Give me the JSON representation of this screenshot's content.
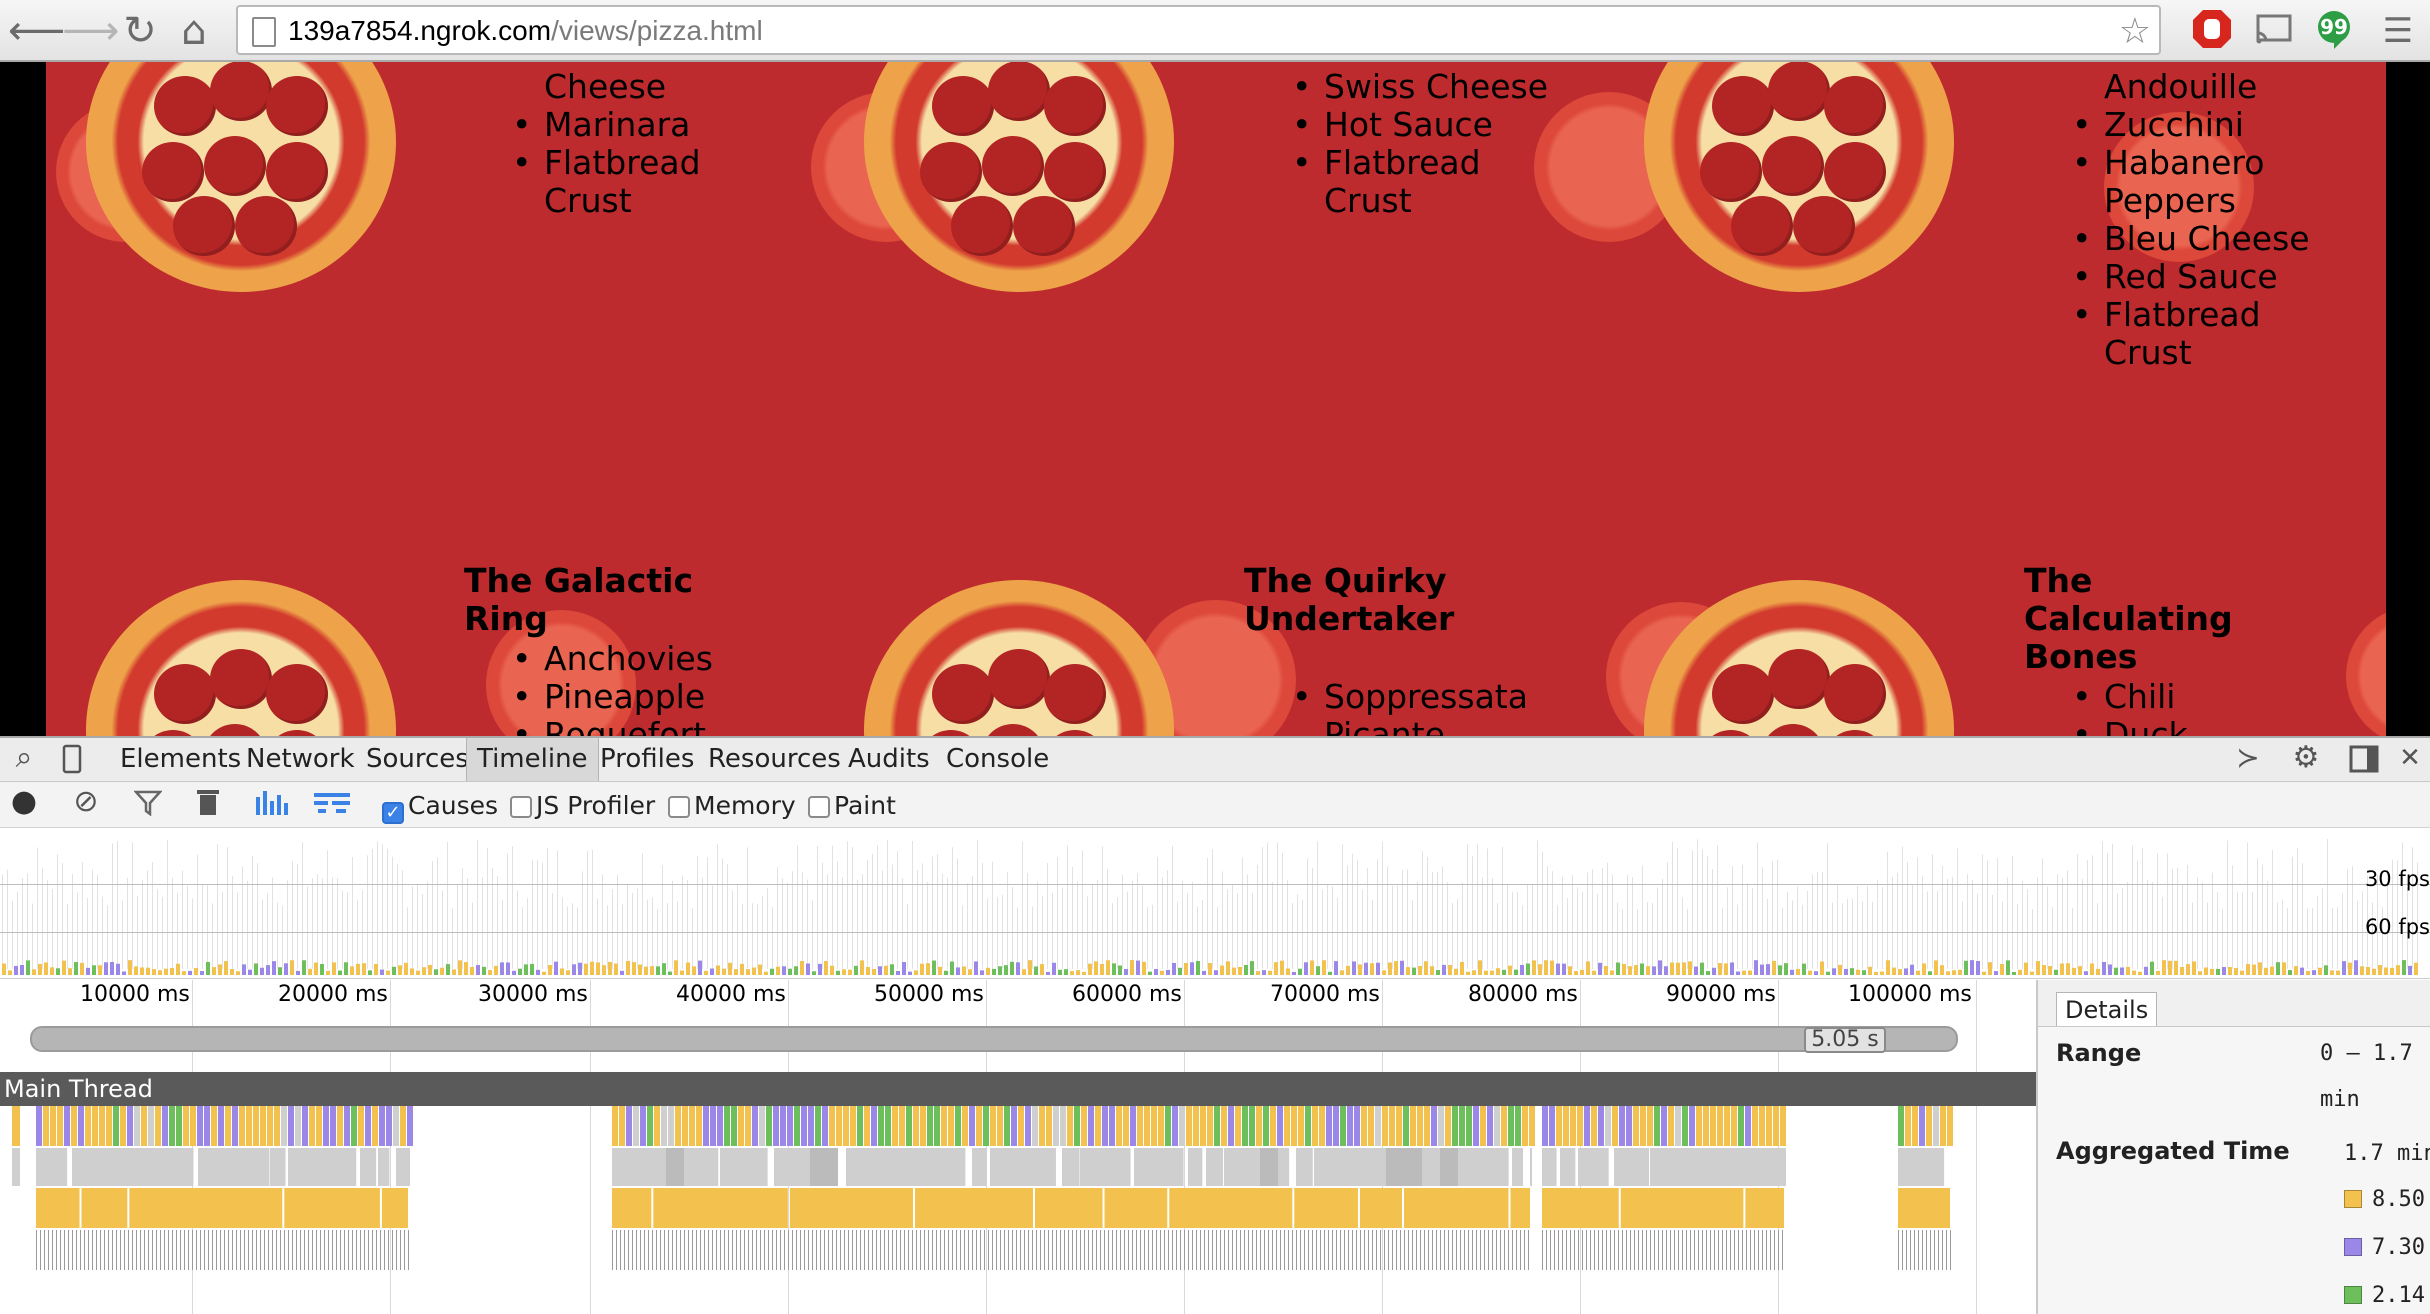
{
  "browser": {
    "url_host": "139a7854.ngrok.com",
    "url_path": "/views/pizza.html",
    "back_icon": "back-arrow-icon",
    "forward_icon": "forward-arrow-icon",
    "reload_icon": "reload-icon",
    "home_icon": "home-icon"
  },
  "page": {
    "background": "#be2b2e",
    "top_row": [
      {
        "items": [
          "Cheese",
          "Marinara",
          "Flatbread Crust"
        ],
        "first_no_bullet": true
      },
      {
        "items": [
          "Swiss Cheese",
          "Hot Sauce",
          "Flatbread Crust"
        ],
        "first_no_bullet": false
      },
      {
        "items": [
          "Andouille",
          "Zucchini",
          "Habanero Peppers",
          "Bleu Cheese",
          "Red Sauce",
          "Flatbread Crust"
        ],
        "first_no_bullet": true
      }
    ],
    "bottom_row": [
      {
        "title": "The Galactic Ring",
        "items": [
          "Anchovies",
          "Pineapple",
          "Roquefort"
        ]
      },
      {
        "title": "The Quirky Undertaker",
        "items": [
          "Soppressata Picante"
        ]
      },
      {
        "title": "The Calculating Bones",
        "items": [
          "Chili",
          "Duck"
        ]
      }
    ]
  },
  "devtools": {
    "tabs": [
      "Elements",
      "Network",
      "Sources",
      "Timeline",
      "Profiles",
      "Resources",
      "Audits",
      "Console"
    ],
    "active_tab": "Timeline",
    "toolbar": {
      "causes": "Causes",
      "js_profiler": "JS Profiler",
      "memory": "Memory",
      "paint": "Paint",
      "causes_checked": true,
      "js_profiler_checked": false,
      "memory_checked": false,
      "paint_checked": false
    },
    "fps_30": "30 fps",
    "fps_60": "60 fps",
    "ruler_ticks": [
      "10000 ms",
      "20000 ms",
      "30000 ms",
      "40000 ms",
      "50000 ms",
      "60000 ms",
      "70000 ms",
      "80000 ms",
      "90000 ms",
      "100000 ms"
    ],
    "range_label": "5.05 s",
    "main_thread": "Main Thread",
    "details": {
      "tab": "Details",
      "range_label": "Range",
      "range_value_1": "0 – 1.7",
      "range_value_2": "min",
      "aggregated_label": "Aggregated Time",
      "aggregated_total": "1.7 min",
      "rows": [
        {
          "color": "#f2c14e",
          "value": "8.50"
        },
        {
          "color": "#9b87e8",
          "value": "7.30"
        },
        {
          "color": "#6cbf5a",
          "value": "2.14"
        }
      ]
    },
    "colors": {
      "scripting": "#f2c14e",
      "rendering": "#9b87e8",
      "painting": "#6cbf5a",
      "idle": "#cfcfcf"
    }
  }
}
